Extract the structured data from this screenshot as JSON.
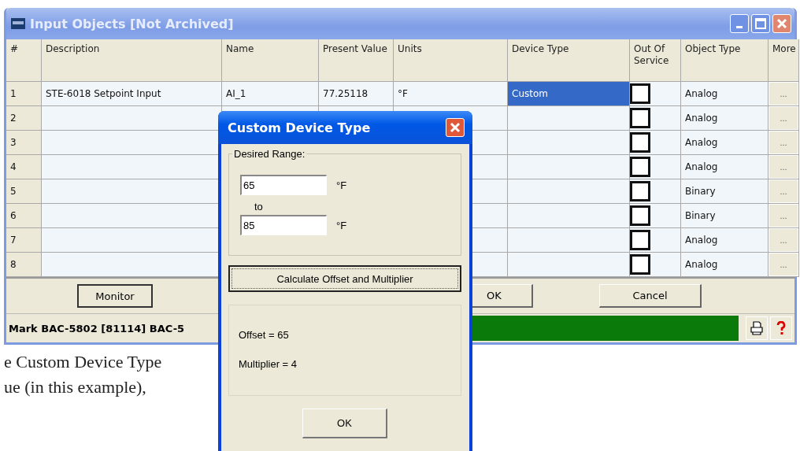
{
  "window": {
    "title": "Input Objects [Not Archived]"
  },
  "table": {
    "columns": [
      "#",
      "Description",
      "Name",
      "Present Value",
      "Units",
      "Device Type",
      "Out Of Service",
      "Object Type",
      "More"
    ],
    "rows": [
      {
        "number": "1",
        "description": "STE-6018 Setpoint Input",
        "name": "AI_1",
        "present_value": "77.25118",
        "units": "°F",
        "device_type": "Custom",
        "selected": true,
        "out_of_service": false,
        "object_type": "Analog",
        "more": "..."
      },
      {
        "number": "2",
        "selected": false,
        "out_of_service": false,
        "object_type": "Analog",
        "more": "..."
      },
      {
        "number": "3",
        "selected": false,
        "out_of_service": false,
        "object_type": "Analog",
        "more": "..."
      },
      {
        "number": "4",
        "selected": false,
        "out_of_service": false,
        "object_type": "Analog",
        "more": "..."
      },
      {
        "number": "5",
        "selected": false,
        "out_of_service": false,
        "object_type": "Binary",
        "more": "..."
      },
      {
        "number": "6",
        "selected": false,
        "out_of_service": false,
        "object_type": "Binary",
        "more": "..."
      },
      {
        "number": "7",
        "selected": false,
        "out_of_service": false,
        "object_type": "Analog",
        "more": "..."
      },
      {
        "number": "8",
        "selected": false,
        "out_of_service": false,
        "object_type": "Analog",
        "more": "..."
      }
    ]
  },
  "buttons": [
    "Monitor",
    "OK",
    "Cancel"
  ],
  "status_bar": {
    "text": "Mark BAC-5802 [81114] BAC-5"
  },
  "dialog": {
    "title": "Custom Device Type",
    "group_label": "Desired Range:",
    "from": {
      "value": "65",
      "unit": "°F"
    },
    "to_label": "to",
    "to": {
      "value": "85",
      "unit": "°F"
    },
    "calculate_button": "Calculate Offset and Multiplier",
    "results": [
      "Offset = 65",
      "Multiplier = 4"
    ],
    "ok_button": "OK"
  },
  "document_text": [
    "e Custom Device Type",
    "ue (in this example),"
  ]
}
